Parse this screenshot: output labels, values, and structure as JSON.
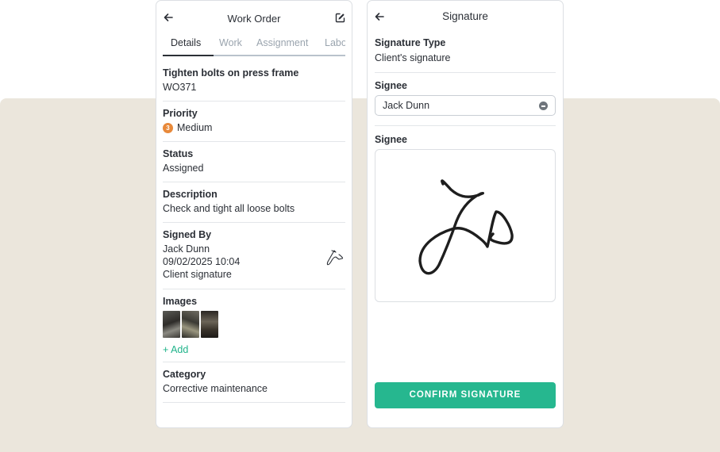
{
  "work_order": {
    "title": "Work Order",
    "tabs": [
      "Details",
      "Work",
      "Assignment",
      "Labo"
    ],
    "task_title": "Tighten bolts on press frame",
    "task_id": "WO371",
    "priority_label": "Priority",
    "priority_number": "3",
    "priority_value": "Medium",
    "status_label": "Status",
    "status_value": "Assigned",
    "description_label": "Description",
    "description_value": "Check and tight all loose bolts",
    "signed_by_label": "Signed By",
    "signed_by_name": "Jack Dunn",
    "signed_by_datetime": "09/02/2025  10:04",
    "signed_by_type": "Client signature",
    "images_label": "Images",
    "add_label": "+ Add",
    "category_label": "Category",
    "category_value": "Corrective maintenance"
  },
  "signature": {
    "title": "Signature",
    "type_label": "Signature Type",
    "type_value": "Client's signature",
    "signee_label": "Signee",
    "signee_value": "Jack Dunn",
    "pad_label": "Signee",
    "confirm_label": "CONFIRM SIGNATURE"
  },
  "colors": {
    "accent": "#26b78f",
    "add_link": "#1fb38a",
    "priority_badge": "#e8893a",
    "backdrop": "#ebe6dc"
  },
  "icons": [
    "back-arrow-icon",
    "edit-icon",
    "clear-icon",
    "signature-thumbnail"
  ]
}
